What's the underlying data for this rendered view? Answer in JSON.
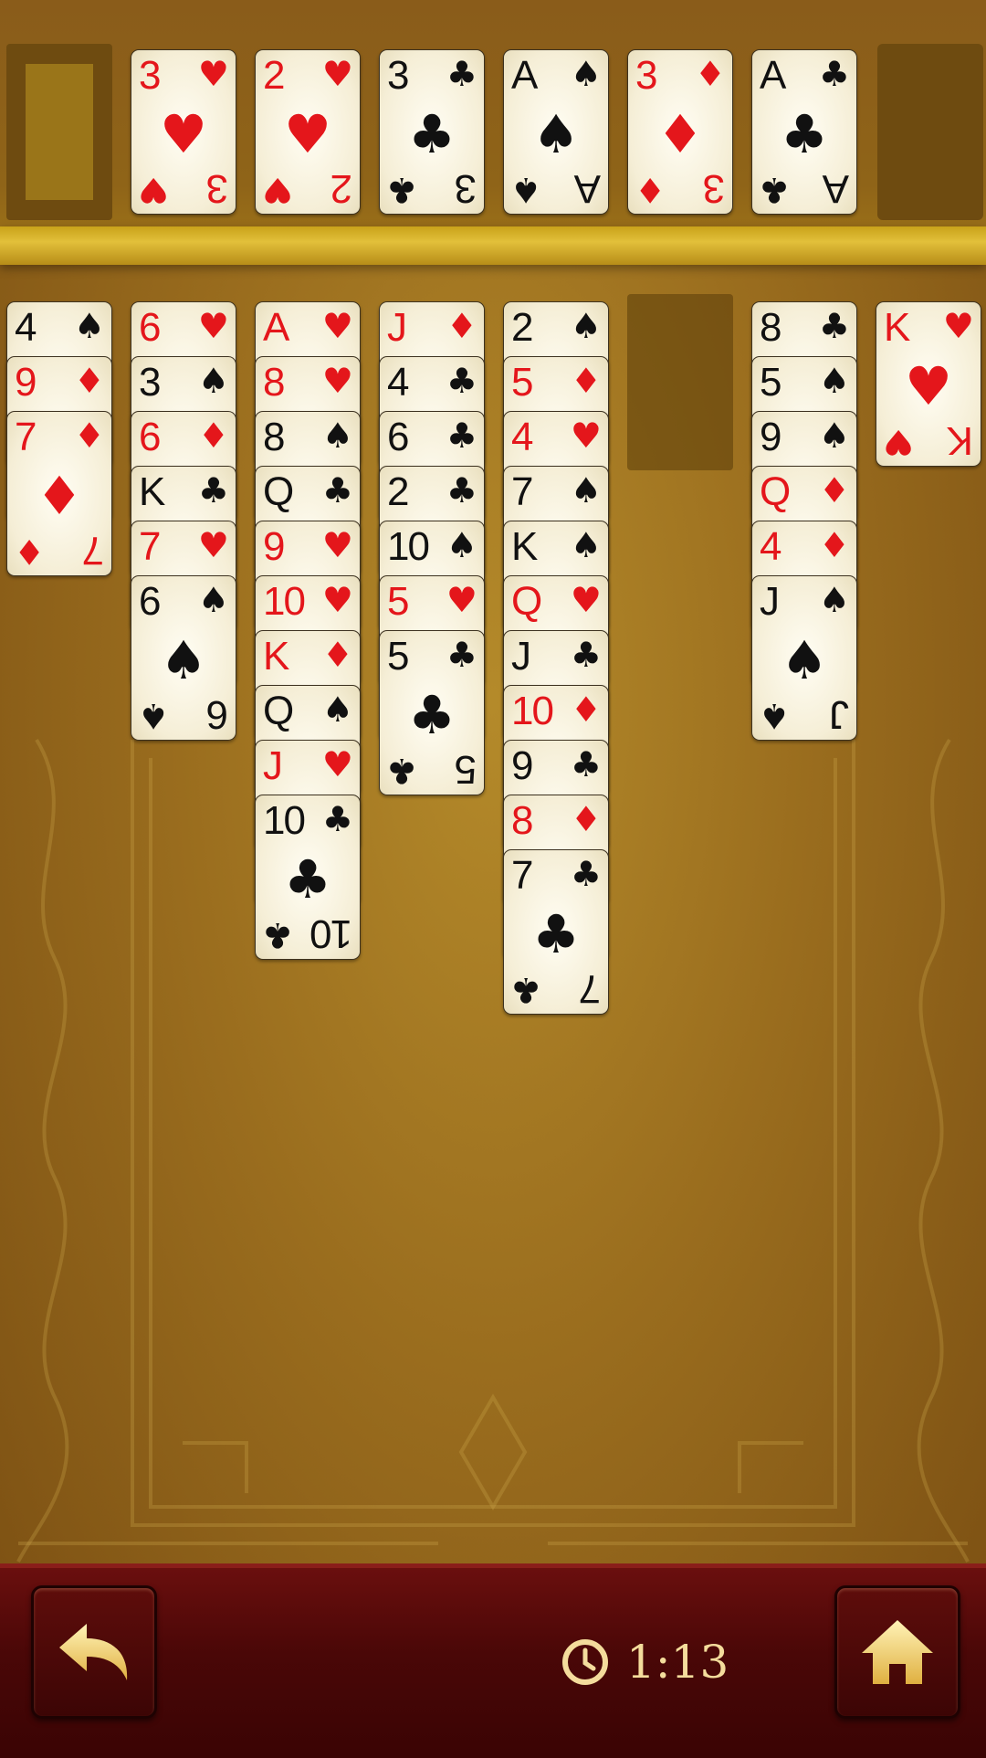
{
  "foundations": [
    {
      "rank": "3",
      "suit": "♥",
      "color": "red"
    },
    {
      "rank": "2",
      "suit": "♥",
      "color": "red"
    },
    {
      "rank": "3",
      "suit": "♣",
      "color": "black"
    },
    {
      "rank": "A",
      "suit": "♠",
      "color": "black"
    },
    {
      "rank": "3",
      "suit": "♦",
      "color": "red"
    },
    {
      "rank": "A",
      "suit": "♣",
      "color": "black"
    }
  ],
  "tableau": [
    [
      {
        "rank": "4",
        "suit": "♠",
        "color": "black"
      },
      {
        "rank": "9",
        "suit": "♦",
        "color": "red"
      },
      {
        "rank": "7",
        "suit": "♦",
        "color": "red"
      }
    ],
    [
      {
        "rank": "6",
        "suit": "♥",
        "color": "red"
      },
      {
        "rank": "3",
        "suit": "♠",
        "color": "black"
      },
      {
        "rank": "6",
        "suit": "♦",
        "color": "red"
      },
      {
        "rank": "K",
        "suit": "♣",
        "color": "black"
      },
      {
        "rank": "7",
        "suit": "♥",
        "color": "red"
      },
      {
        "rank": "6",
        "suit": "♠",
        "color": "black"
      }
    ],
    [
      {
        "rank": "A",
        "suit": "♥",
        "color": "red"
      },
      {
        "rank": "8",
        "suit": "♥",
        "color": "red"
      },
      {
        "rank": "8",
        "suit": "♠",
        "color": "black"
      },
      {
        "rank": "Q",
        "suit": "♣",
        "color": "black"
      },
      {
        "rank": "9",
        "suit": "♥",
        "color": "red"
      },
      {
        "rank": "10",
        "suit": "♥",
        "color": "red"
      },
      {
        "rank": "K",
        "suit": "♦",
        "color": "red"
      },
      {
        "rank": "Q",
        "suit": "♠",
        "color": "black"
      },
      {
        "rank": "J",
        "suit": "♥",
        "color": "red"
      },
      {
        "rank": "10",
        "suit": "♣",
        "color": "black"
      }
    ],
    [
      {
        "rank": "J",
        "suit": "♦",
        "color": "red"
      },
      {
        "rank": "4",
        "suit": "♣",
        "color": "black"
      },
      {
        "rank": "6",
        "suit": "♣",
        "color": "black"
      },
      {
        "rank": "2",
        "suit": "♣",
        "color": "black"
      },
      {
        "rank": "10",
        "suit": "♠",
        "color": "black"
      },
      {
        "rank": "5",
        "suit": "♥",
        "color": "red"
      },
      {
        "rank": "5",
        "suit": "♣",
        "color": "black"
      }
    ],
    [
      {
        "rank": "2",
        "suit": "♠",
        "color": "black"
      },
      {
        "rank": "5",
        "suit": "♦",
        "color": "red"
      },
      {
        "rank": "4",
        "suit": "♥",
        "color": "red"
      },
      {
        "rank": "7",
        "suit": "♠",
        "color": "black"
      },
      {
        "rank": "K",
        "suit": "♠",
        "color": "black"
      },
      {
        "rank": "Q",
        "suit": "♥",
        "color": "red"
      },
      {
        "rank": "J",
        "suit": "♣",
        "color": "black"
      },
      {
        "rank": "10",
        "suit": "♦",
        "color": "red"
      },
      {
        "rank": "9",
        "suit": "♣",
        "color": "black"
      },
      {
        "rank": "8",
        "suit": "♦",
        "color": "red"
      },
      {
        "rank": "7",
        "suit": "♣",
        "color": "black"
      }
    ],
    [],
    [
      {
        "rank": "8",
        "suit": "♣",
        "color": "black"
      },
      {
        "rank": "5",
        "suit": "♠",
        "color": "black"
      },
      {
        "rank": "9",
        "suit": "♠",
        "color": "black"
      },
      {
        "rank": "Q",
        "suit": "♦",
        "color": "red"
      },
      {
        "rank": "4",
        "suit": "♦",
        "color": "red"
      },
      {
        "rank": "J",
        "suit": "♠",
        "color": "black"
      }
    ],
    [
      {
        "rank": "K",
        "suit": "♥",
        "color": "red"
      }
    ]
  ],
  "timer": {
    "value": "1:13",
    "icon": "clock-icon"
  },
  "buttons": {
    "undo_icon": "undo-arrow-icon",
    "home_icon": "home-icon"
  },
  "colors": {
    "red_suit": "#e4161b",
    "black_suit": "#111111",
    "table_gold": "#a8801f",
    "bar_maroon": "#4a0707"
  }
}
